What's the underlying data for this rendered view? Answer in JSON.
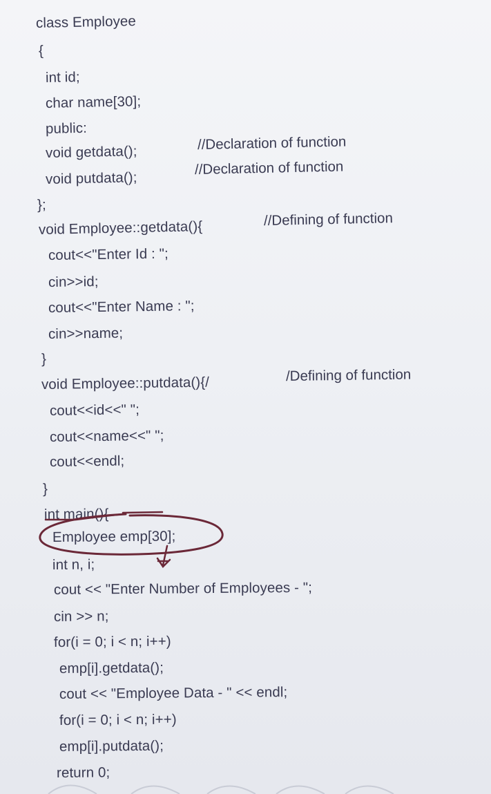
{
  "code": {
    "lines": [
      "class Employee",
      "{",
      "int id;",
      "char name[30];",
      "public:",
      "void getdata();",
      "void putdata();",
      "};",
      "void Employee::getdata(){",
      "cout<<\"Enter Id : \";",
      "cin>>id;",
      "cout<<\"Enter Name : \";",
      "cin>>name;",
      "}",
      "void Employee::putdata(){/",
      "cout<<id<<\" \";",
      "cout<<name<<\" \";",
      "cout<<endl;",
      "}",
      "int main(){",
      "Employee emp[30];",
      "int n, i;",
      "cout << \"Enter Number of Employees - \";",
      "cin >> n;",
      "for(i = 0; i < n; i++)",
      "emp[i].getdata();",
      "cout << \"Employee Data - \" << endl;",
      "for(i = 0; i < n; i++)",
      "emp[i].putdata();",
      "return 0;"
    ],
    "comments": {
      "getdata_decl": "//Declaration of function",
      "putdata_decl": "//Declaration of function",
      "getdata_def": "//Defining of function",
      "putdata_def": "/Defining of function"
    }
  },
  "colors": {
    "text": "#3a3b52",
    "annotation_ink": "#6b2838",
    "background": "#f2f3f6"
  }
}
